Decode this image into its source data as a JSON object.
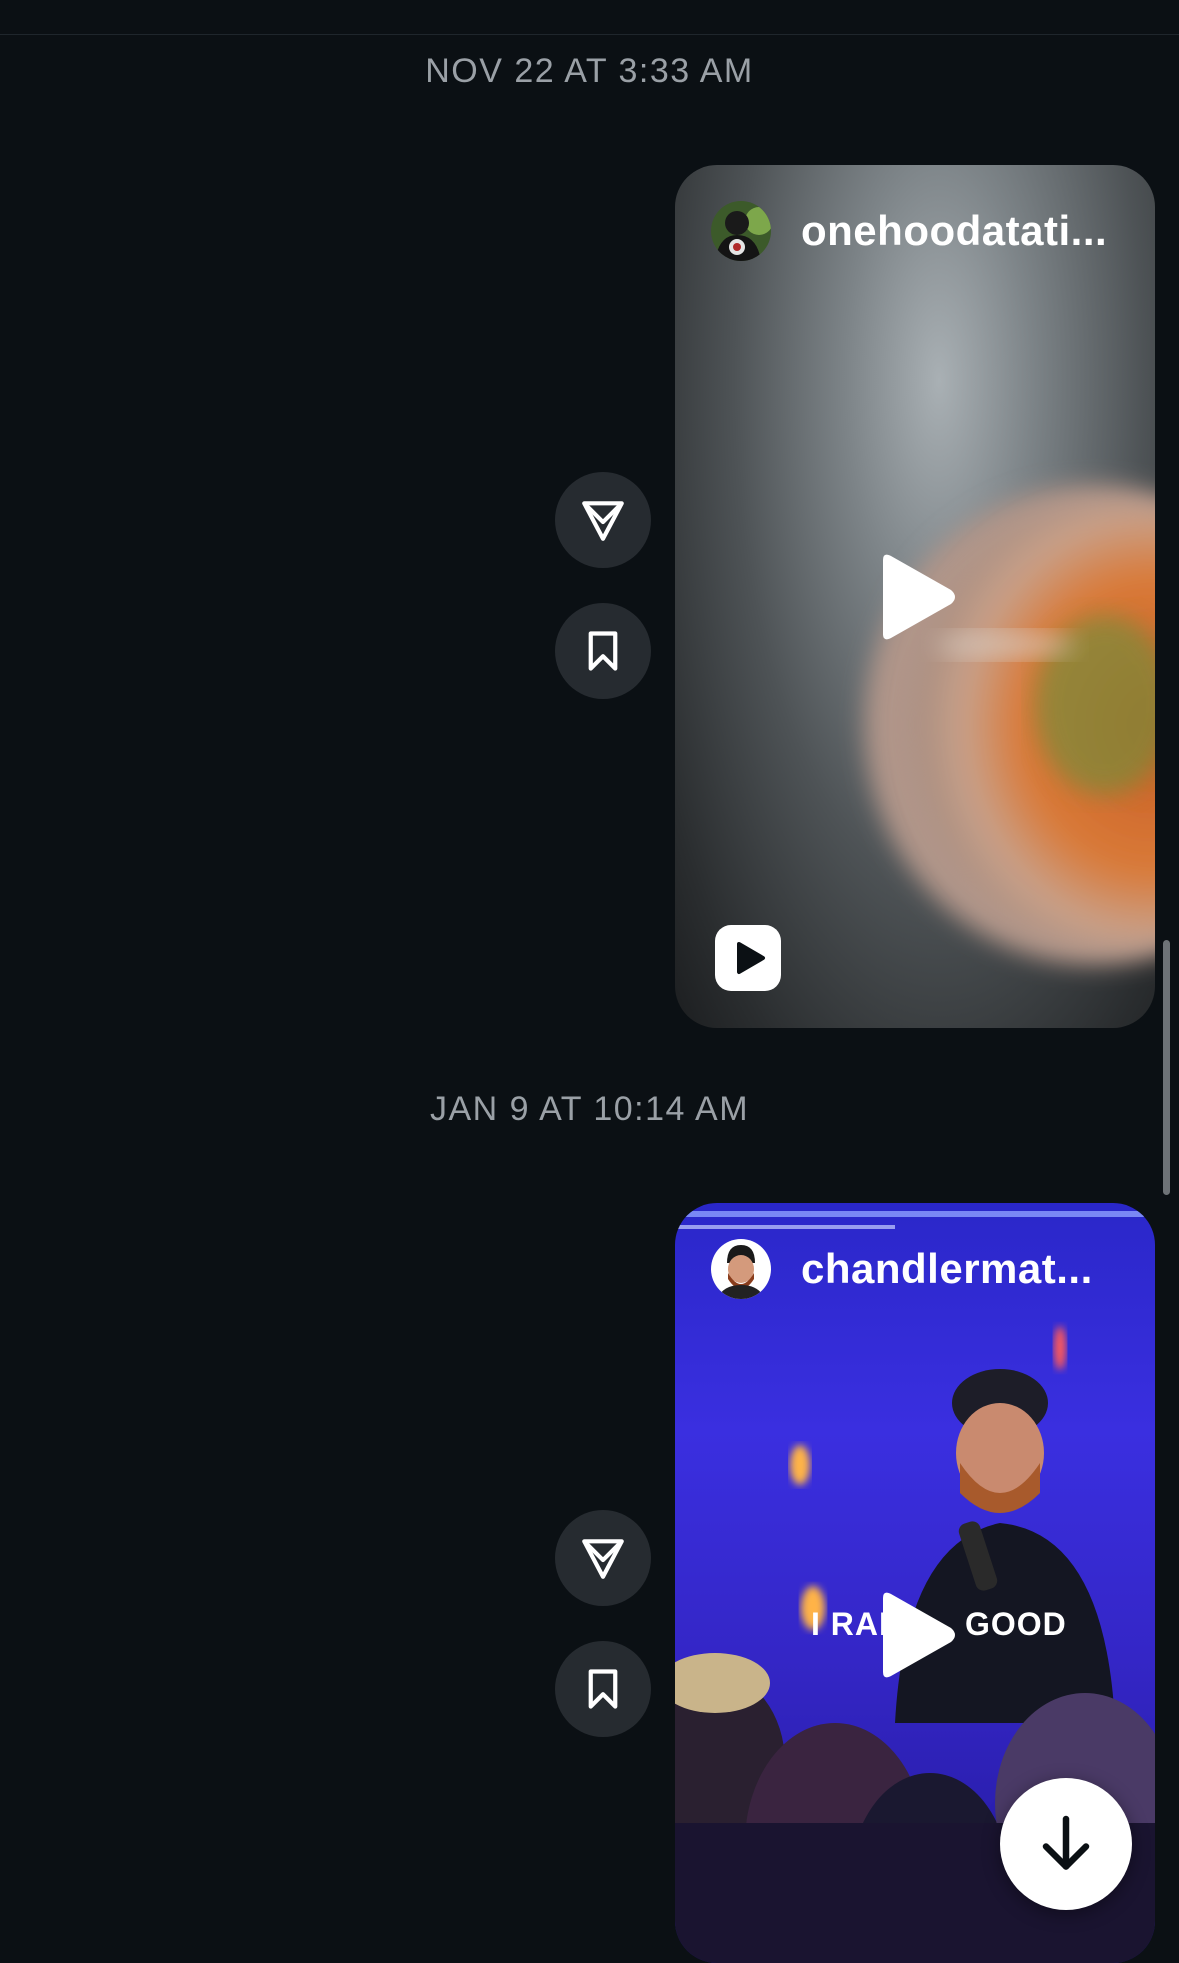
{
  "messages": [
    {
      "timestamp": "NOV 22 AT 3:33 AM",
      "reel": {
        "username": "onehoodatati...",
        "media": "blurred-food-plate-video"
      }
    },
    {
      "timestamp": "JAN 9 AT 10:14 AM",
      "reel": {
        "username": "chandlermat...",
        "media": "concert-performer-video",
        "overlay_text": "I RAP GOOD"
      }
    }
  ],
  "icons": {
    "share": "paper-plane-icon",
    "save": "bookmark-icon",
    "play": "play-icon",
    "reel": "reel-badge-icon",
    "scroll": "arrow-down-icon"
  },
  "colors": {
    "background": "#0b1014",
    "timestamp": "#9aa0a6",
    "button_bg": "#262b30",
    "accent": "#ffffff"
  }
}
